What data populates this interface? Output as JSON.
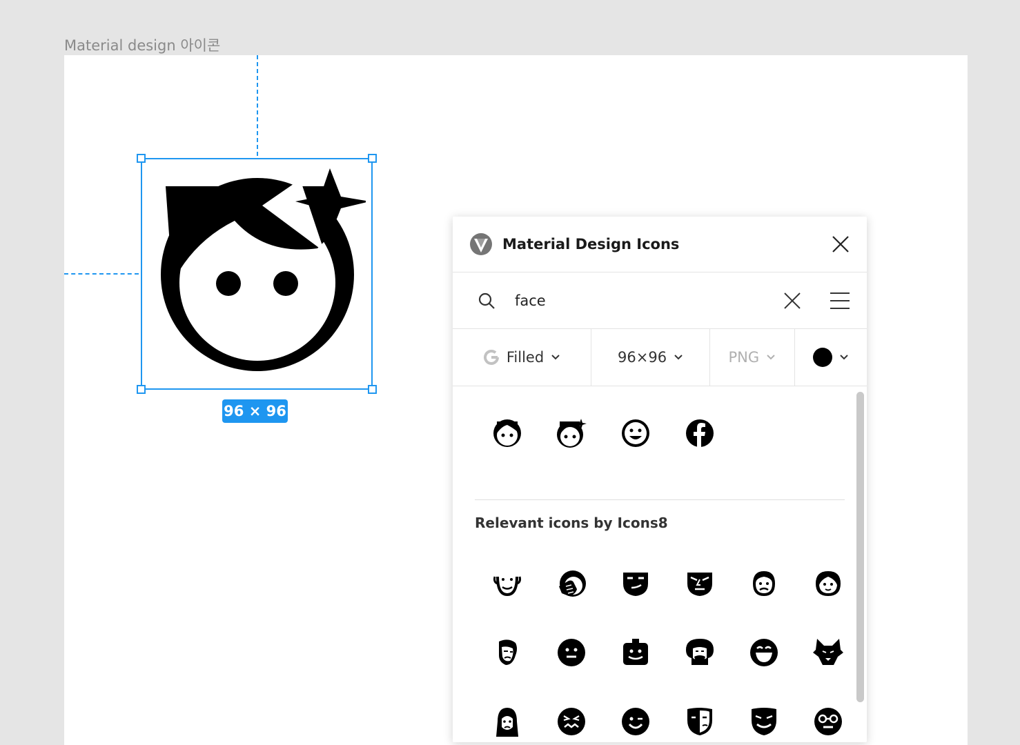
{
  "canvas": {
    "frame_label": "Material design 아이콘",
    "selection_size": "96 × 96",
    "selected_icon": "face-retouching-natural-icon"
  },
  "panel": {
    "title": "Material Design Icons",
    "logo": "material-design-logo",
    "search": {
      "value": "face",
      "placeholder": ""
    },
    "options": {
      "style": "Filled",
      "size": "96×96",
      "format": "PNG",
      "color": "#000000"
    },
    "results": [
      "face-icon",
      "face-retouching-natural-icon",
      "sentiment-satisfied-icon",
      "facebook-icon"
    ],
    "relevant_section_title": "Relevant icons by Icons8",
    "relevant_rows": [
      [
        "smiling-face-icon",
        "facepalm-icon",
        "tough-face-icon",
        "suspicious-face-icon",
        "sad-boy-icon",
        "boy-face-icon"
      ],
      [
        "scared-man-icon",
        "neutral-face-icon",
        "robot-face-icon",
        "afro-man-icon",
        "laughing-face-icon",
        "wolf-icon"
      ],
      [
        "sad-woman-icon",
        "confounded-face-icon",
        "winking-face-icon",
        "theater-mask-icon",
        "grinning-mask-icon",
        "nerd-face-icon"
      ]
    ]
  }
}
